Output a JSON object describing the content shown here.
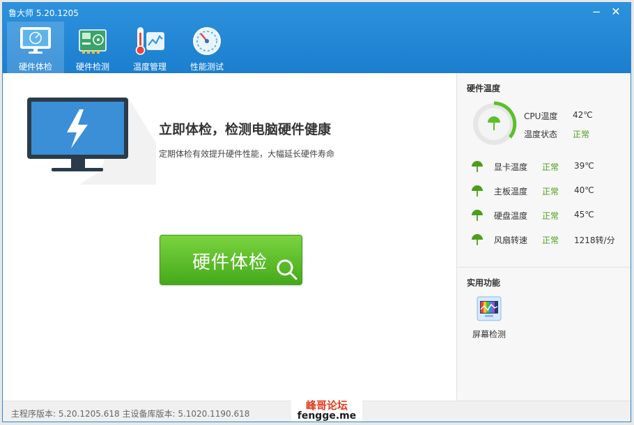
{
  "window": {
    "title": "鲁大师 5.20.1205",
    "minimize_glyph": "−",
    "close_glyph": "✕"
  },
  "tabs": [
    {
      "label": "硬件体检",
      "icon": "monitor-check-icon",
      "active": true
    },
    {
      "label": "硬件检测",
      "icon": "hardware-board-icon",
      "active": false
    },
    {
      "label": "温度管理",
      "icon": "thermometer-icon",
      "active": false
    },
    {
      "label": "性能测试",
      "icon": "speedometer-icon",
      "active": false
    }
  ],
  "main": {
    "headline": "立即体检，检测电脑硬件健康",
    "subline": "定期体检有效提升硬件性能，大幅延长硬件寿命",
    "check_button_label": "硬件体检",
    "art_icon": "monitor-lightning-icon"
  },
  "panel": {
    "temperature_title": "硬件温度",
    "cpu": {
      "temp_label": "CPU温度",
      "temp_value": "42℃",
      "status_label": "温度状态",
      "status_value": "正常"
    },
    "sensors": [
      {
        "name": "显卡温度",
        "status": "正常",
        "value": "39℃"
      },
      {
        "name": "主板温度",
        "status": "正常",
        "value": "40℃"
      },
      {
        "name": "硬盘温度",
        "status": "正常",
        "value": "45℃"
      },
      {
        "name": "风扇转速",
        "status": "正常",
        "value": "1218转/分"
      }
    ],
    "tools_title": "实用功能",
    "tools": [
      {
        "label": "屏幕检测",
        "icon": "screen-test-icon"
      }
    ]
  },
  "statusbar": {
    "version_text": "主程序版本: 5.20.1205.618   主设备库版本: 5.1020.1190.618"
  },
  "watermark": {
    "line1": "峰哥论坛",
    "line2": "fengge.me"
  },
  "colors": {
    "header": "#1b7ecf",
    "ok_green": "#4c9e1c",
    "button_green": "#45a91b",
    "watermark_red": "#e23b1a"
  }
}
